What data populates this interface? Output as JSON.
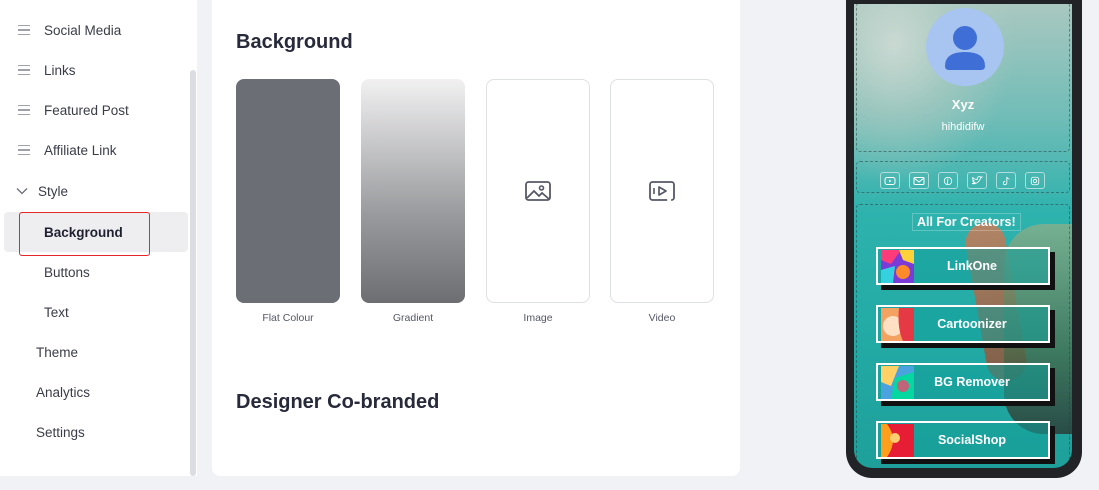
{
  "sidebar": {
    "items": [
      {
        "label": "Social Media",
        "icon": "menu-lines-icon"
      },
      {
        "label": "Links",
        "icon": "menu-lines-icon"
      },
      {
        "label": "Featured Post",
        "icon": "menu-lines-icon"
      },
      {
        "label": "Affiliate Link",
        "icon": "menu-lines-icon"
      }
    ],
    "style_group": {
      "label": "Style",
      "expanded": true
    },
    "style_subitems": [
      {
        "label": "Background",
        "active": true
      },
      {
        "label": "Buttons"
      },
      {
        "label": "Text"
      }
    ],
    "bottom_items": [
      {
        "label": "Theme"
      },
      {
        "label": "Analytics"
      },
      {
        "label": "Settings"
      }
    ]
  },
  "main": {
    "background_title": "Background",
    "tiles": [
      {
        "label": "Flat Colour",
        "color": "#6b6e75"
      },
      {
        "label": "Gradient"
      },
      {
        "label": "Image",
        "icon": "image-icon"
      },
      {
        "label": "Video",
        "icon": "video-icon"
      }
    ],
    "designer_title": "Designer Co-branded"
  },
  "preview": {
    "name": "Xyz",
    "bio": "hihdidifw",
    "social_icons": [
      "youtube-icon",
      "mail-icon",
      "pinterest-icon",
      "twitter-icon",
      "tiktok-icon",
      "instagram-icon"
    ],
    "heading": "All For Creators!",
    "links": [
      {
        "label": "LinkOne"
      },
      {
        "label": "Cartoonizer"
      },
      {
        "label": "BG Remover"
      },
      {
        "label": "SocialShop"
      }
    ]
  },
  "colors": {
    "accent_red": "#e5262b",
    "avatar_bg": "#a8c4f0",
    "avatar_fg": "#3f6fd6",
    "screen_teal": "#23aba6"
  }
}
